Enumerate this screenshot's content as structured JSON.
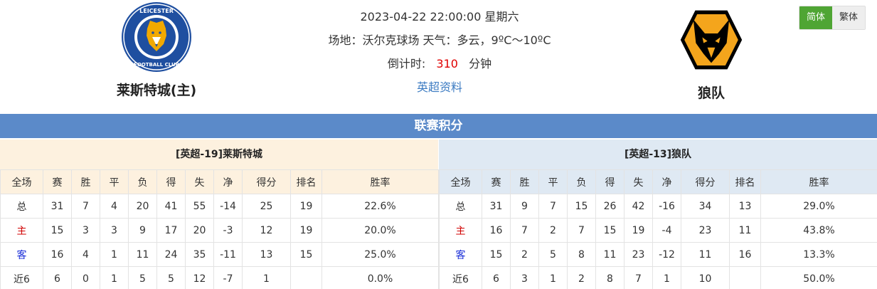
{
  "match": {
    "datetime": "2023-04-22 22:00:00 星期六",
    "venue_weather": "场地：沃尔克球场 天气：多云，9ºC～10ºC",
    "countdown_label": "倒计时:",
    "countdown_value": "310",
    "countdown_unit": "分钟",
    "league_link": "英超资料"
  },
  "home_team": {
    "name": "莱斯特城(主)",
    "logo_icon": "leicester-city-crest"
  },
  "away_team": {
    "name": "狼队",
    "logo_icon": "wolves-crest"
  },
  "language": {
    "simplified": "简体",
    "traditional": "繁体"
  },
  "section_title": "联赛积分",
  "colors": {
    "section_bar": "#5b8ac9",
    "home_header": "#fdf1df",
    "away_header": "#dfe9f3",
    "active_lang": "#4fa534",
    "countdown": "#e00000"
  },
  "standings": {
    "columns": [
      "全场",
      "赛",
      "胜",
      "平",
      "负",
      "得",
      "失",
      "净",
      "得分",
      "排名",
      "胜率"
    ],
    "home": {
      "title": "[英超-19]莱斯特城",
      "rows": [
        [
          "总",
          "31",
          "7",
          "4",
          "20",
          "41",
          "55",
          "-14",
          "25",
          "19",
          "22.6%"
        ],
        [
          "主",
          "15",
          "3",
          "3",
          "9",
          "17",
          "20",
          "-3",
          "12",
          "19",
          "20.0%"
        ],
        [
          "客",
          "16",
          "4",
          "1",
          "11",
          "24",
          "35",
          "-11",
          "13",
          "15",
          "25.0%"
        ],
        [
          "近6",
          "6",
          "0",
          "1",
          "5",
          "5",
          "12",
          "-7",
          "1",
          "",
          "0.0%"
        ]
      ]
    },
    "away": {
      "title": "[英超-13]狼队",
      "rows": [
        [
          "总",
          "31",
          "9",
          "7",
          "15",
          "26",
          "42",
          "-16",
          "34",
          "13",
          "29.0%"
        ],
        [
          "主",
          "16",
          "7",
          "2",
          "7",
          "15",
          "19",
          "-4",
          "23",
          "11",
          "43.8%"
        ],
        [
          "客",
          "15",
          "2",
          "5",
          "8",
          "11",
          "23",
          "-12",
          "11",
          "16",
          "13.3%"
        ],
        [
          "近6",
          "6",
          "3",
          "1",
          "2",
          "8",
          "7",
          "1",
          "10",
          "",
          "50.0%"
        ]
      ]
    }
  }
}
